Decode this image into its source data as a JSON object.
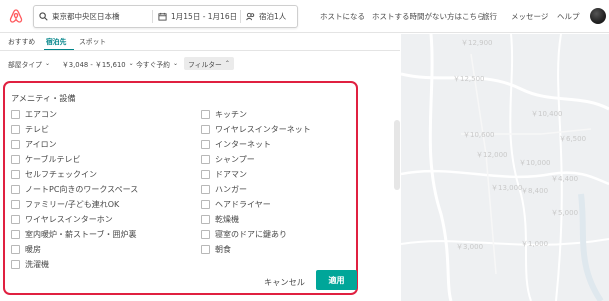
{
  "header": {
    "search": {
      "location": "東京都中央区日本橋",
      "dates": "1月15日 - 1月16日",
      "guests": "宿泊1人"
    },
    "nav": [
      "ホストになる",
      "ホストする時間がない方はこちら",
      "旅行",
      "メッセージ",
      "ヘルプ"
    ]
  },
  "tabs": [
    {
      "label": "おすすめ"
    },
    {
      "label": "宿泊先"
    },
    {
      "label": "スポット"
    }
  ],
  "filters": {
    "room_type": "部屋タイプ",
    "price": "￥3,048 - ￥15,610",
    "instant_book": "今すぐ予約",
    "more": "フィルター"
  },
  "amenities": {
    "title": "アメニティ・設備",
    "left": [
      "エアコン",
      "テレビ",
      "アイロン",
      "ケーブルテレビ",
      "セルフチェックイン",
      "ノートPC向きのワークスペース",
      "ファミリー/子ども連れOK",
      "ワイヤレスインターホン",
      "室内暖炉・薪ストーブ・囲炉裏",
      "暖房",
      "洗濯機"
    ],
    "right": [
      "キッチン",
      "ワイヤレスインターネット",
      "インターネット",
      "シャンプー",
      "ドアマン",
      "ハンガー",
      "ヘアドライヤー",
      "乾燥機",
      "寝室のドアに鍵あり",
      "朝食"
    ],
    "cancel_label": "キャンセル",
    "apply_label": "適用"
  },
  "map": {
    "prices": [
      "￥12,900",
      "￥12,500",
      "￥10,400",
      "￥10,600",
      "￥6,500",
      "￥12,000",
      "￥10,000",
      "￥4,400",
      "￥13,000",
      "￥8,400",
      "￥5,000",
      "￥1,000",
      "￥3,000"
    ]
  },
  "colors": {
    "accent": "#008489",
    "apply": "#00a699",
    "highlight": "#e02040",
    "brand": "#ff5a5f"
  }
}
